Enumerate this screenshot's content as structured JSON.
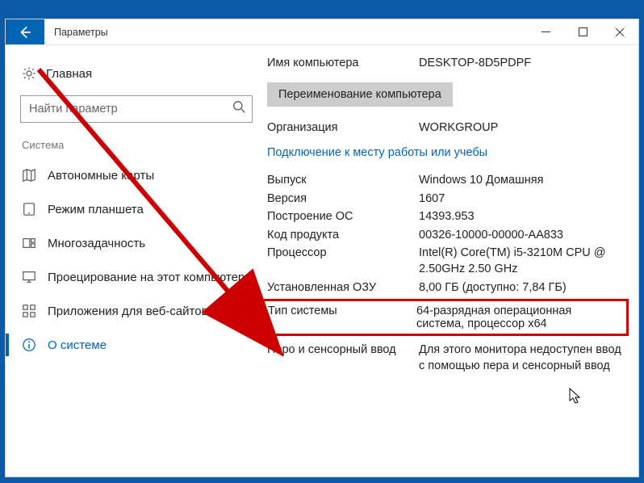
{
  "window": {
    "title": "Параметры"
  },
  "sidebar": {
    "home_label": "Главная",
    "search_placeholder": "Найти параметр",
    "section_label": "Система",
    "items": [
      {
        "label": "Автономные карты"
      },
      {
        "label": "Режим планшета"
      },
      {
        "label": "Многозадачность"
      },
      {
        "label": "Проецирование на этот компьютер"
      },
      {
        "label": "Приложения для веб-сайтов"
      },
      {
        "label": "О системе"
      }
    ]
  },
  "content": {
    "computer_name_label": "Имя компьютера",
    "computer_name_value": "DESKTOP-8D5PDPF",
    "rename_button": "Переименование компьютера",
    "org_label": "Организация",
    "org_value": "WORKGROUP",
    "connect_link": "Подключение к месту работы или учебы",
    "edition_label": "Выпуск",
    "edition_value": "Windows 10 Домашняя",
    "version_label": "Версия",
    "version_value": "1607",
    "build_label": "Построение ОС",
    "build_value": "14393.953",
    "product_label": "Код продукта",
    "product_value": "00326-10000-00000-AA833",
    "cpu_label": "Процессор",
    "cpu_value": "Intel(R) Core(TM) i5-3210M CPU @ 2.50GHz   2.50 GHz",
    "ram_label": "Установленная ОЗУ",
    "ram_value": "8,00 ГБ (доступно: 7,84 ГБ)",
    "type_label": "Тип системы",
    "type_value": "64-разрядная операционная система, процессор x64",
    "pen_label": "Перо и сенсорный ввод",
    "pen_value": "Для этого монитора недоступен ввод с помощью пера и сенсорный ввод"
  },
  "highlight_color": "#c00"
}
